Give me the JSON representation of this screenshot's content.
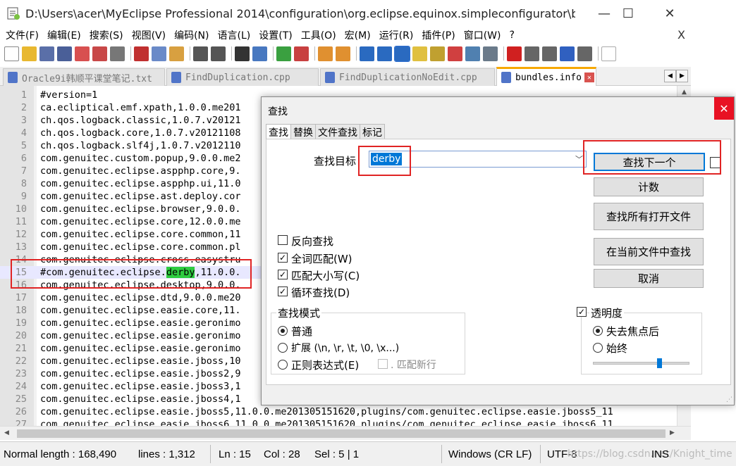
{
  "window": {
    "title": "D:\\Users\\acer\\MyEclipse Professional 2014\\configuration\\org.eclipse.equinox.simpleconfigurator\\bundl...",
    "minimize": "—",
    "maximize": "☐",
    "close": "✕"
  },
  "menu": {
    "items": [
      "文件(F)",
      "编辑(E)",
      "搜索(S)",
      "视图(V)",
      "编码(N)",
      "语言(L)",
      "设置(T)",
      "工具(O)",
      "宏(M)",
      "运行(R)",
      "插件(P)",
      "窗口(W)",
      "?"
    ],
    "close": "X"
  },
  "tabs": [
    {
      "label": "Oracle9i韩顺平课堂笔记.txt",
      "active": false
    },
    {
      "label": "FindDuplication.cpp",
      "active": false
    },
    {
      "label": "FindDuplicationNoEdit.cpp",
      "active": false
    },
    {
      "label": "bundles.info",
      "active": true
    }
  ],
  "editor": {
    "lines": [
      {
        "n": "1",
        "text": "#version=1"
      },
      {
        "n": "2",
        "text": "ca.ecliptical.emf.xpath,1.0.0.me201"
      },
      {
        "n": "3",
        "text": "ch.qos.logback.classic,1.0.7.v20121"
      },
      {
        "n": "4",
        "text": "ch.qos.logback.core,1.0.7.v20121108"
      },
      {
        "n": "5",
        "text": "ch.qos.logback.slf4j,1.0.7.v2012110"
      },
      {
        "n": "6",
        "text": "com.genuitec.custom.popup,9.0.0.me2"
      },
      {
        "n": "7",
        "text": "com.genuitec.eclipse.aspphp.core,9."
      },
      {
        "n": "8",
        "text": "com.genuitec.eclipse.aspphp.ui,11.0"
      },
      {
        "n": "9",
        "text": "com.genuitec.eclipse.ast.deploy.cor"
      },
      {
        "n": "10",
        "text": "com.genuitec.eclipse.browser,9.0.0."
      },
      {
        "n": "11",
        "text": "com.genuitec.eclipse.core,12.0.0.me"
      },
      {
        "n": "12",
        "text": "com.genuitec.eclipse.core.common,11"
      },
      {
        "n": "13",
        "text": "com.genuitec.eclipse.core.common.pl"
      },
      {
        "n": "14",
        "text": "com.genuitec.eclipse.cross.easystru"
      },
      {
        "n": "15",
        "pre": "#com.genuitec.eclipse.",
        "match": "derby",
        "post": ",11.0.0."
      },
      {
        "n": "16",
        "text": "com.genuitec.eclipse.desktop,9.0.0."
      },
      {
        "n": "17",
        "text": "com.genuitec.eclipse.dtd,9.0.0.me20"
      },
      {
        "n": "18",
        "text": "com.genuitec.eclipse.easie.core,11."
      },
      {
        "n": "19",
        "text": "com.genuitec.eclipse.easie.geronimo"
      },
      {
        "n": "20",
        "text": "com.genuitec.eclipse.easie.geronimo"
      },
      {
        "n": "21",
        "text": "com.genuitec.eclipse.easie.geronimo"
      },
      {
        "n": "22",
        "text": "com.genuitec.eclipse.easie.jboss,10"
      },
      {
        "n": "23",
        "text": "com.genuitec.eclipse.easie.jboss2,9"
      },
      {
        "n": "24",
        "text": "com.genuitec.eclipse.easie.jboss3,1"
      },
      {
        "n": "25",
        "text": "com.genuitec.eclipse.easie.jboss4,1"
      },
      {
        "n": "26",
        "text": "com.genuitec.eclipse.easie.jboss5,11.0.0.me201305151620,plugins/com.genuitec.eclipse.easie.jboss5_11"
      },
      {
        "n": "27",
        "text": "com.genuitec.eclipse.easie.jboss6,11.0.0.me201305151620,plugins/com.genuitec.eclipse.easie.jboss6_11"
      }
    ]
  },
  "status": {
    "length": "Normal length : 168,490",
    "lines": "lines : 1,312",
    "ln": "Ln : 15",
    "col": "Col : 28",
    "sel": "Sel : 5 | 1",
    "eol": "Windows (CR LF)",
    "encoding": "UTF-8",
    "mode": "INS",
    "watermark": "https://blog.csdn.net/Knight_time"
  },
  "find_dialog": {
    "title": "查找",
    "close": "✕",
    "tabs": [
      "查找",
      "替换",
      "文件查找",
      "标记"
    ],
    "target_label": "查找目标",
    "target_value": "derby",
    "buttons": {
      "find_next": "查找下一个",
      "count": "计数",
      "find_all_open": "查找所有打开文件",
      "find_in_current": "在当前文件中查找",
      "cancel": "取消"
    },
    "options": {
      "reverse": {
        "label": "反向查找",
        "checked": false
      },
      "whole_word": {
        "label": "全词匹配(W)",
        "checked": true
      },
      "match_case": {
        "label": "匹配大小写(C)",
        "checked": true
      },
      "wrap": {
        "label": "循环查找(D)",
        "checked": true
      }
    },
    "mode": {
      "title": "查找模式",
      "normal": "普通",
      "extended": "扩展 (\\n, \\r, \\t, \\0, \\x...)",
      "regex": "正则表达式(E)",
      "dot_newline": ". 匹配新行",
      "selected": "normal"
    },
    "transparency": {
      "title": "透明度",
      "checked": true,
      "on_lose_focus": "失去焦点后",
      "always": "始终",
      "selected": "on_lose_focus",
      "level": 0.7
    }
  }
}
